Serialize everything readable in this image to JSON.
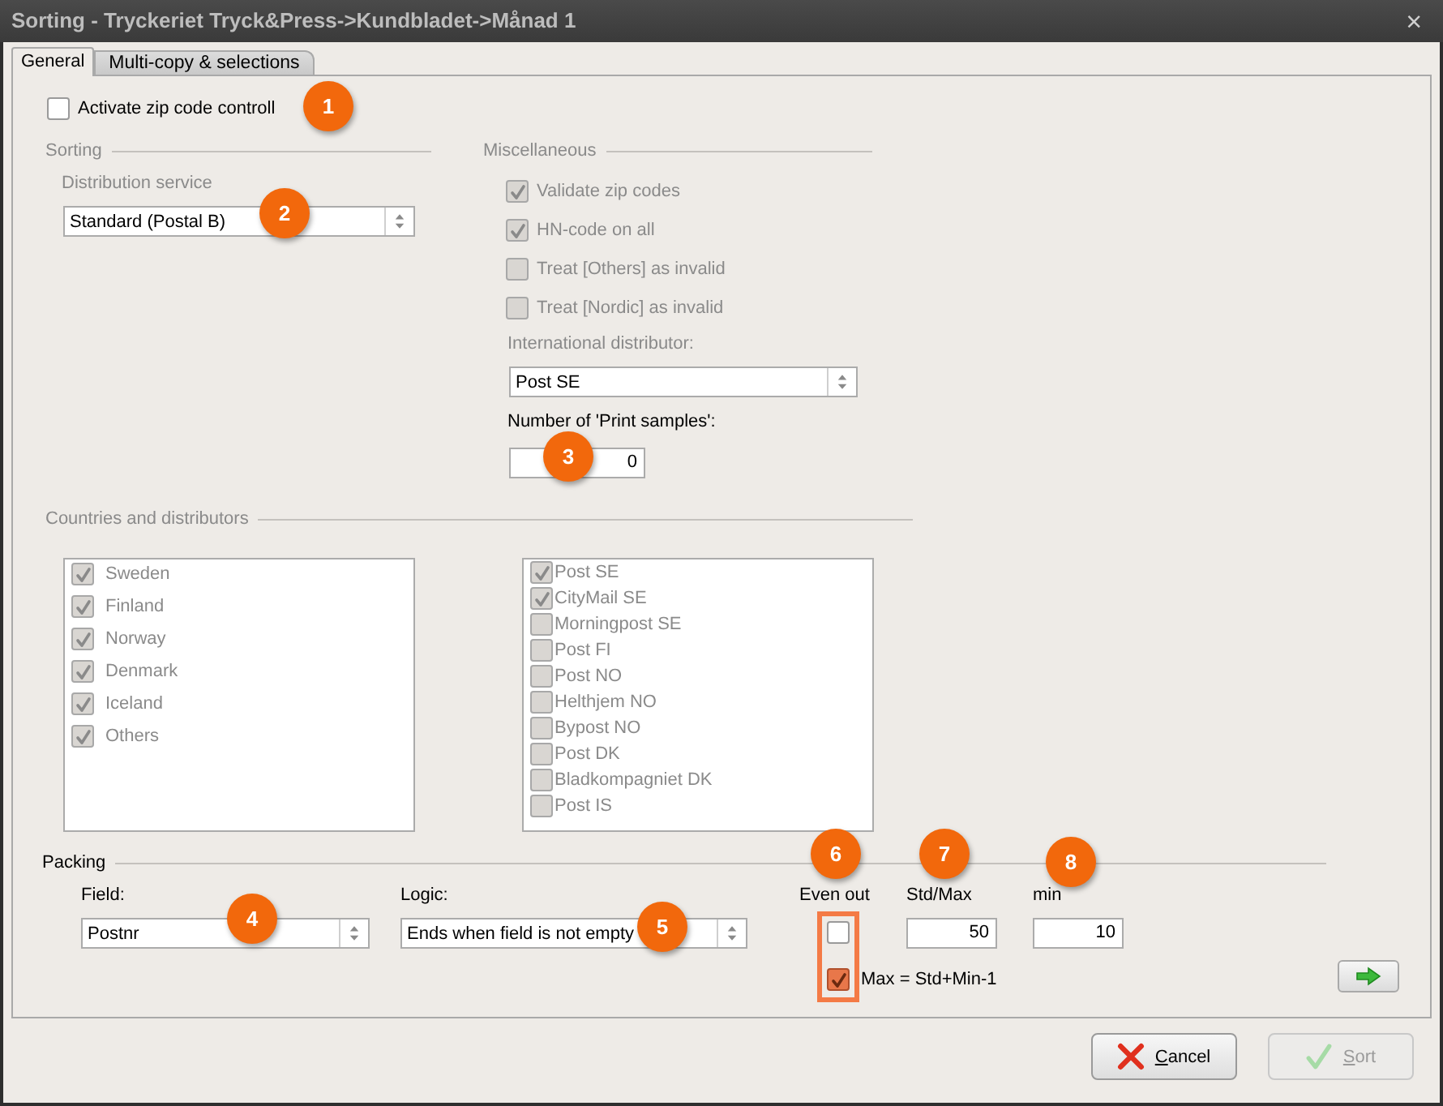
{
  "window": {
    "title": "Sorting - Tryckeriet Tryck&Press->Kundbladet->Månad 1",
    "close": "×"
  },
  "tabs": [
    {
      "label": "General",
      "selected": true
    },
    {
      "label": "Multi-copy & selections",
      "selected": false
    }
  ],
  "activate_zip": {
    "label": "Activate zip code controll",
    "checked": false
  },
  "sorting": {
    "title": "Sorting",
    "distribution_service": {
      "label": "Distribution service",
      "value": "Standard (Postal B)"
    }
  },
  "miscellaneous": {
    "title": "Miscellaneous",
    "options": [
      {
        "label": "Validate zip codes",
        "checked": true,
        "disabled": true
      },
      {
        "label": "HN-code on all",
        "checked": true,
        "disabled": true
      },
      {
        "label": "Treat [Others] as invalid",
        "checked": false,
        "disabled": true
      },
      {
        "label": "Treat [Nordic] as invalid",
        "checked": false,
        "disabled": true
      }
    ],
    "international_distributor": {
      "label": "International distributor:",
      "value": "Post SE"
    },
    "print_samples": {
      "label": "Number of 'Print samples':",
      "value": "0"
    }
  },
  "countries_and_distributors": {
    "title": "Countries and distributors",
    "countries": [
      {
        "label": "Sweden",
        "checked": true
      },
      {
        "label": "Finland",
        "checked": true
      },
      {
        "label": "Norway",
        "checked": true
      },
      {
        "label": "Denmark",
        "checked": true
      },
      {
        "label": "Iceland",
        "checked": true
      },
      {
        "label": "Others",
        "checked": true
      }
    ],
    "distributors": [
      {
        "label": "Post SE",
        "checked": true
      },
      {
        "label": "CityMail SE",
        "checked": true
      },
      {
        "label": "Morningpost SE",
        "checked": false
      },
      {
        "label": "Post FI",
        "checked": false
      },
      {
        "label": "Post NO",
        "checked": false
      },
      {
        "label": "Helthjem NO",
        "checked": false
      },
      {
        "label": "Bypost NO",
        "checked": false
      },
      {
        "label": "Post DK",
        "checked": false
      },
      {
        "label": "Bladkompagniet DK",
        "checked": false
      },
      {
        "label": "Post IS",
        "checked": false
      }
    ]
  },
  "packing": {
    "title": "Packing",
    "field": {
      "label": "Field:",
      "value": "Postnr"
    },
    "logic": {
      "label": "Logic:",
      "value": "Ends when field is not empty"
    },
    "even_out": {
      "label": "Even out",
      "checked": false
    },
    "std_max": {
      "label": "Std/Max",
      "value": "50"
    },
    "min": {
      "label": "min",
      "value": "10"
    },
    "max_rule": {
      "label": "Max = Std+Min-1",
      "checked": true
    }
  },
  "callouts": [
    "1",
    "2",
    "3",
    "4",
    "5",
    "6",
    "7",
    "8"
  ],
  "buttons": [
    {
      "kind": "cancel",
      "label": "Cancel",
      "disabled": false
    },
    {
      "kind": "sort",
      "label": "Sort",
      "disabled": true
    }
  ]
}
